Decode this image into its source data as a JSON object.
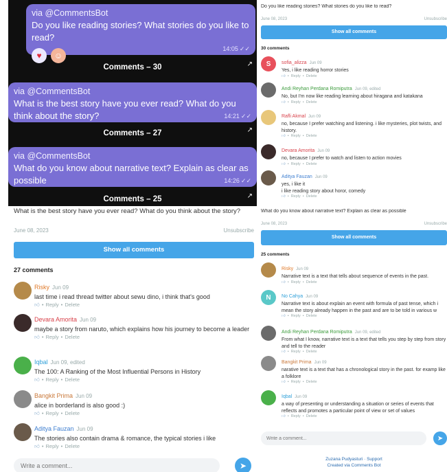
{
  "chat": {
    "posts": [
      {
        "via": "via @CommentsBot",
        "text": "Do you like reading stories? What stories do you like to read?",
        "time": "14:05",
        "comments": "Comments – 30"
      },
      {
        "via": "via @CommentsBot",
        "text": "What is the best story have you ever read? What do you think about the story?",
        "time": "14:21",
        "comments": "Comments – 27"
      },
      {
        "via": "via @CommentsBot",
        "text": "What do you know about narrative text? Explain as clear as possible",
        "time": "14:26",
        "comments": "Comments – 25"
      }
    ],
    "reactions": [
      "heart-icon",
      "face-icon"
    ]
  },
  "widget_left": {
    "post": "What is the best story have you ever read? What do you think about the story?",
    "date": "June 08, 2023",
    "unsubscribe": "Unsubscribe",
    "show_all": "Show all comments",
    "count": "27 comments",
    "input_placeholder": "Write a comment...",
    "comments": [
      {
        "name": "Risky",
        "time": "Jun 09",
        "text": "last time i read thread twitter about sewu dino, i think that's good",
        "color": "#e07a2a"
      },
      {
        "name": "Devara Amorita",
        "time": "Jun 09",
        "text": "maybe a story from naruto, which explains how his journey to become a leader",
        "color": "#d8414a"
      },
      {
        "name": "Iqbal",
        "time": "Jun 09, edited",
        "text": "The 100: A Ranking of the Most Influential Persons in History",
        "color": "#2e9fd8"
      },
      {
        "name": "Bangkit Prima",
        "time": "Jun 09",
        "text": "alice in borderland is also good :)",
        "color": "#c9783a"
      },
      {
        "name": "Aditya Fauzan",
        "time": "Jun 09",
        "text": "The stories also contain drama & romance, the typical stories i like",
        "color": "#3f7fd0"
      }
    ]
  },
  "widget_right_top": {
    "post": "Do you like reading stories? What stories do you like to read?",
    "date": "June 08, 2023",
    "unsubscribe": "Unsubscribe",
    "show_all": "Show all comments",
    "count": "30 comments",
    "comments": [
      {
        "name": "sofia_alizza",
        "time": "Jun 09",
        "text": "Yes, i like reading horror stories",
        "initial": "S",
        "color": "#d8414a",
        "avatar_bg": "#e8505b"
      },
      {
        "name": "Andi Reyhan Perdana Romiputra",
        "time": "Jun 09, edited",
        "text": "No, but I'm now like reading learning about hiragana and katakana",
        "initial": "",
        "color": "#3a9a3a",
        "avatar_bg": "#6b6b6b"
      },
      {
        "name": "Rafli Akmal",
        "time": "Jun 09",
        "text": "no, because I prefer watching and listening. i like mysteries, plot twists, and history.",
        "initial": "",
        "color": "#d8414a",
        "avatar_bg": "#e8c77a"
      },
      {
        "name": "Devara Amorita",
        "time": "Jun 09",
        "text": "no, because I prefer to watch and listen to action movies",
        "initial": "",
        "color": "#d8414a",
        "avatar_bg": "#3a2a2a"
      },
      {
        "name": "Aditya Fauzan",
        "time": "Jun 09",
        "text": "yes, i like it\ni like reading story about horor, comedy",
        "initial": "",
        "color": "#3f7fd0",
        "avatar_bg": "#6a5a4a"
      }
    ]
  },
  "widget_right_bottom": {
    "post": "What do you know about narrative text? Explain as clear as possible",
    "date": "June 08, 2023",
    "unsubscribe": "Unsubscribe",
    "show_all": "Show all comments",
    "count": "25 comments",
    "input_placeholder": "Write a comment...",
    "footer_support": "Zuzana Pudyasturi · Support",
    "footer_created": "Created via Comments Bot",
    "comments": [
      {
        "name": "Risky",
        "time": "Jun 09",
        "text": "Narrative text is a text that tells about sequence of events in the past.",
        "initial": "",
        "color": "#e07a2a",
        "avatar_bg": "#b58a4a"
      },
      {
        "name": "No Cahya",
        "time": "Jun 09",
        "text": "Narrative text is about explain an event with formula of past tense, which i mean the story already happen in the past and are to be told in various w",
        "initial": "N",
        "color": "#2e9fd8",
        "avatar_bg": "#5ac8c8"
      },
      {
        "name": "Andi Reyhan Perdana Romiputra",
        "time": "Jun 09, edited",
        "text": "From what I know, narrative text is a text that tells you step by step from story and tell to the reader",
        "initial": "",
        "color": "#3a9a3a",
        "avatar_bg": "#6b6b6b"
      },
      {
        "name": "Bangkit Prima",
        "time": "Jun 09",
        "text": "narative text is a text that has a chronological story in the past. for examp like a folklore",
        "initial": "",
        "color": "#c9783a",
        "avatar_bg": "#8a8a8a"
      },
      {
        "name": "Iqbal",
        "time": "Jun 09",
        "text": "a way of presenting or understanding a situation or series of events that reflects and promotes a particular point of view or set of values",
        "initial": "",
        "color": "#2e9fd8",
        "avatar_bg": "#4ab04a"
      }
    ]
  },
  "common": {
    "reply": "Reply",
    "delete": "Delete",
    "dot": "•"
  }
}
